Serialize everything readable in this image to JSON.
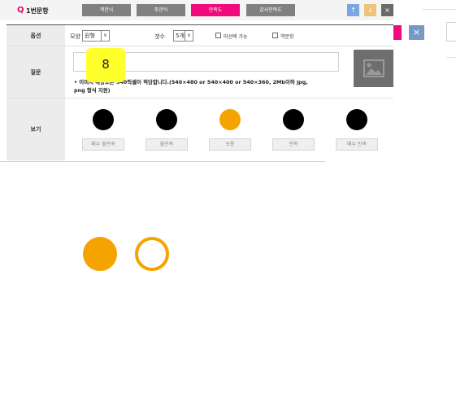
{
  "header": {
    "q_mark": "Q",
    "title": "1번문항",
    "tabs": [
      {
        "label": "객관식",
        "active": false
      },
      {
        "label": "주관식",
        "active": false
      },
      {
        "label": "만족도",
        "active": true
      },
      {
        "label": "감사만족도",
        "active": false
      }
    ],
    "controls": {
      "up": "↑",
      "down": "↓",
      "close": "×"
    }
  },
  "ghost": {
    "close": "×"
  },
  "options_row": {
    "label": "옵션",
    "shape_label": "모양",
    "shape_value": "원형",
    "count_label": "갯수",
    "count_value": "5개",
    "nonselect_label": "미선택 가능",
    "reverse_label": "역문항"
  },
  "question_row": {
    "label": "질문",
    "badge": "8",
    "note_line1": "• 이미지 해상도는 540픽셀이 적당합니다.(540×480 or 540×400 or 540×360, 2Mb이하 jpg,",
    "note_line2": "png 형식 지원)"
  },
  "choices_row": {
    "label": "보기",
    "choices": [
      {
        "label": "매우 불만족",
        "selected": false
      },
      {
        "label": "불만족",
        "selected": false
      },
      {
        "label": "보통",
        "selected": true
      },
      {
        "label": "만족",
        "selected": false
      },
      {
        "label": "매우 만족",
        "selected": false
      }
    ]
  },
  "colors": {
    "accent": "#ef0b7c",
    "selected": "#f5a300",
    "unselected": "#000000"
  }
}
